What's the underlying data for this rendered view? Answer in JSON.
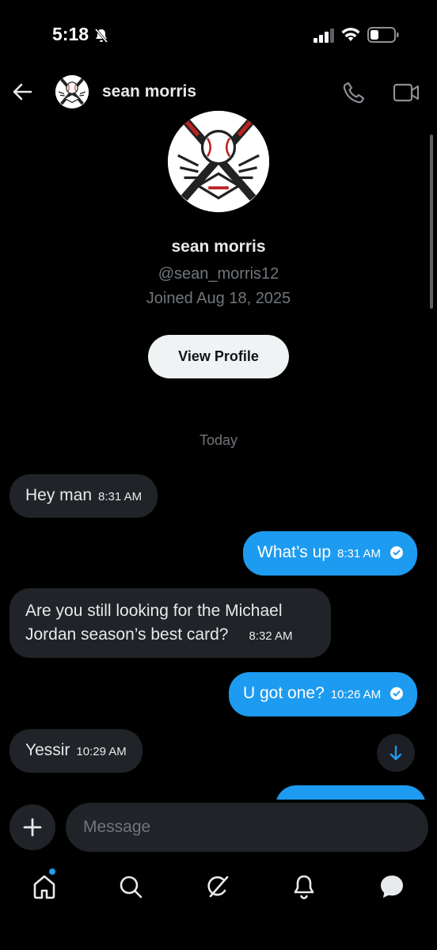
{
  "status_bar": {
    "time": "5:18"
  },
  "header": {
    "name": "sean morris"
  },
  "profile": {
    "name": "sean morris",
    "handle": "@sean_morris12",
    "joined": "Joined Aug 18, 2025",
    "view_profile_label": "View Profile"
  },
  "date_divider": "Today",
  "messages": [
    {
      "direction": "in",
      "text": "Hey man",
      "time": "8:31 AM"
    },
    {
      "direction": "out",
      "text": "What’s up",
      "time": "8:31 AM"
    },
    {
      "direction": "in",
      "line1": "Are you still looking for the Michael",
      "line2": "Jordan season’s best card?",
      "time": "8:32 AM"
    },
    {
      "direction": "out",
      "text": "U got one?",
      "time": "10:26 AM"
    },
    {
      "direction": "in",
      "text": "Yessir",
      "time": "10:29 AM"
    }
  ],
  "composer": {
    "placeholder": "Message"
  },
  "tabs": [
    "home-icon",
    "search-icon",
    "grok-icon",
    "notifications-icon",
    "messages-icon"
  ],
  "colors": {
    "accent": "#1d9bf0",
    "bubble_in": "#202327",
    "background": "#000000"
  }
}
